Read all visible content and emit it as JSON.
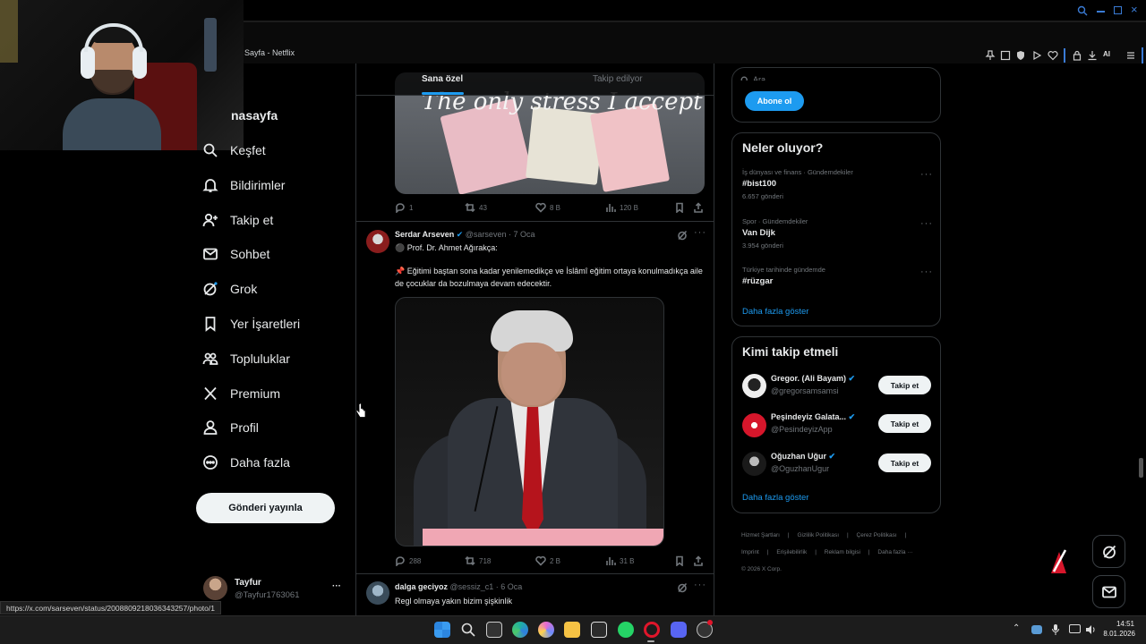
{
  "browser": {
    "tab_title": "Sayfa - Netflix",
    "ai_label": "AI"
  },
  "url_tooltip": "https://x.com/sarseven/status/2008809218036343257/photo/1",
  "nav": {
    "partial_home": "nasayfa",
    "items": [
      "Keşfet",
      "Bildirimler",
      "Takip et",
      "Sohbet",
      "Grok",
      "Yer İşaretleri",
      "Topluluklar",
      "Premium",
      "Profil",
      "Daha fazla"
    ],
    "post_button": "Gönderi yayınla"
  },
  "account": {
    "name": "Tayfur",
    "handle": "@Tayfur1763061",
    "more": "···"
  },
  "feed": {
    "tabs": [
      "Sana özel",
      "Takip edilyor"
    ],
    "image_caption": "The only stress I accept",
    "tweets": [
      {
        "replies": "1",
        "retweets": "43",
        "likes": "8 B",
        "views": "120 B"
      },
      {
        "name": "Serdar Arseven",
        "handle": "@sarseven",
        "date": "· 7 Oca",
        "line1": "⚫ Prof. Dr. Ahmet Ağırakça:",
        "line2": "📌   Eğitimi baştan sona kadar yenilemedikçe ve İslâmî eğitim ortaya konulmadıkça aile de çocuklar da bozulmaya devam edecektir.",
        "replies": "288",
        "retweets": "718",
        "likes": "2 B",
        "views": "31 B"
      },
      {
        "name": "dalga geciyoz",
        "handle": "@sessiz_c1",
        "date": "· 6 Oca",
        "text": "Regl olmaya yakın bizim şişkinlik"
      }
    ]
  },
  "sidebar": {
    "search_placeholder": "Ara",
    "subscribe_button": "Abone ol",
    "trends_title": "Neler oluyor?",
    "trends": [
      {
        "meta": "İş dünyası ve finans · Gündemdekiler",
        "title": "#bist100",
        "count": "6.657 gönderi"
      },
      {
        "meta": "Spor · Gündemdekiler",
        "title": "Van Dijk",
        "count": "3.954 gönderi"
      },
      {
        "meta": "Türkiye tarihinde gündemde",
        "title": "#rüzgar",
        "count": ""
      }
    ],
    "trends_more": "Daha fazla göster",
    "who_title": "Kimi takip etmeli",
    "who": [
      {
        "name": "Gregor. (Ali Bayam)",
        "handle": "@gregorsamsamsi",
        "button": "Takip et"
      },
      {
        "name": "Peşindeyiz Galata...",
        "handle": "@PesindeyizApp",
        "button": "Takip et"
      },
      {
        "name": "Oğuzhan Uğur",
        "handle": "@OguzhanUgur",
        "button": "Takip et"
      }
    ],
    "who_more": "Daha fazla göster",
    "footer": [
      "Hizmet Şartları",
      "|",
      "Gizlilik Politikası",
      "|",
      "Çerez Politikası",
      "|",
      "Imprint",
      "|",
      "Erişilebilirlik",
      "|",
      "Reklam bilgisi",
      "|",
      "Daha fazla ···"
    ],
    "copyright": "© 2026 X Corp."
  },
  "taskbar": {
    "time": "14:51",
    "date": "8.01.2026"
  },
  "colors": {
    "accent": "#1d9bf0",
    "background": "#000000",
    "border": "#2f3336"
  }
}
